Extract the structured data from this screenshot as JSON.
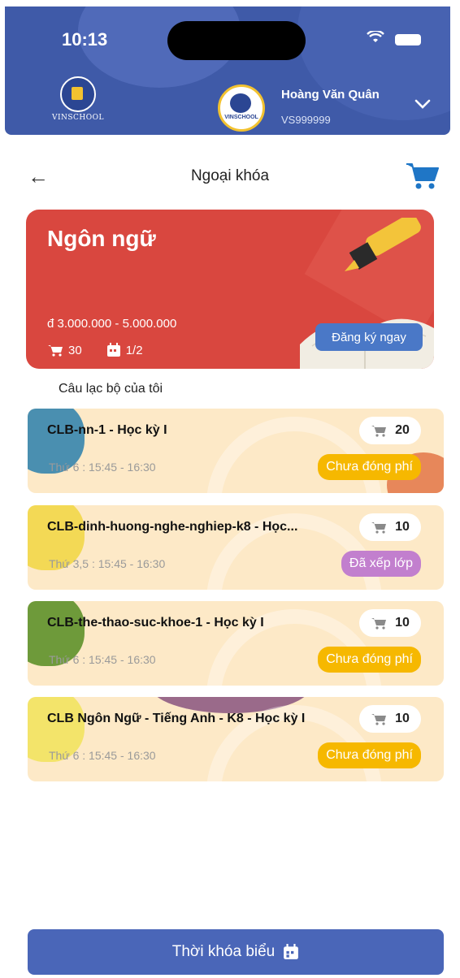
{
  "status_bar": {
    "time": "10:13"
  },
  "header": {
    "logo_text": "VINSCHOOL",
    "avatar_text": "VINSCHOOL",
    "user_name": "Hoàng Văn Quân",
    "user_id": "VS999999"
  },
  "title_bar": {
    "title": "Ngoại khóa"
  },
  "hero": {
    "title": "Ngôn ngữ",
    "price": "đ 3.000.000 - 5.000.000",
    "cart_count": "30",
    "slots": "1/2",
    "register_label": "Đăng ký ngay"
  },
  "section_label": "Câu lạc bộ của tôi",
  "clubs": [
    {
      "name": "CLB-nn-1 - Học kỳ I",
      "time": "Thứ 6 : 15:45 - 16:30",
      "count": "20",
      "status": "Chưa đóng phí",
      "status_color": "#f6b800"
    },
    {
      "name": "CLB-dinh-huong-nghe-nghiep-k8 - Học...",
      "time": "Thứ 3,5 : 15:45 - 16:30",
      "count": "10",
      "status": "Đã xếp lớp",
      "status_color": "#c27fce"
    },
    {
      "name": "CLB-the-thao-suc-khoe-1 - Học kỳ I",
      "time": "Thứ 6 : 15:45 - 16:30",
      "count": "10",
      "status": "Chưa đóng phí",
      "status_color": "#f6b800"
    },
    {
      "name": "CLB Ngôn Ngữ - Tiếng Anh - K8 - Học kỳ I",
      "time": "Thứ 6 : 15:45 - 16:30",
      "count": "10",
      "status": "Chưa đóng phí",
      "status_color": "#f6b800"
    }
  ],
  "footer": {
    "timetable_label": "Thời khóa biểu"
  },
  "colors": {
    "header": "#3f5aa8",
    "hero": "#d9473f",
    "button": "#4a66b8",
    "card": "#fde9c7"
  }
}
